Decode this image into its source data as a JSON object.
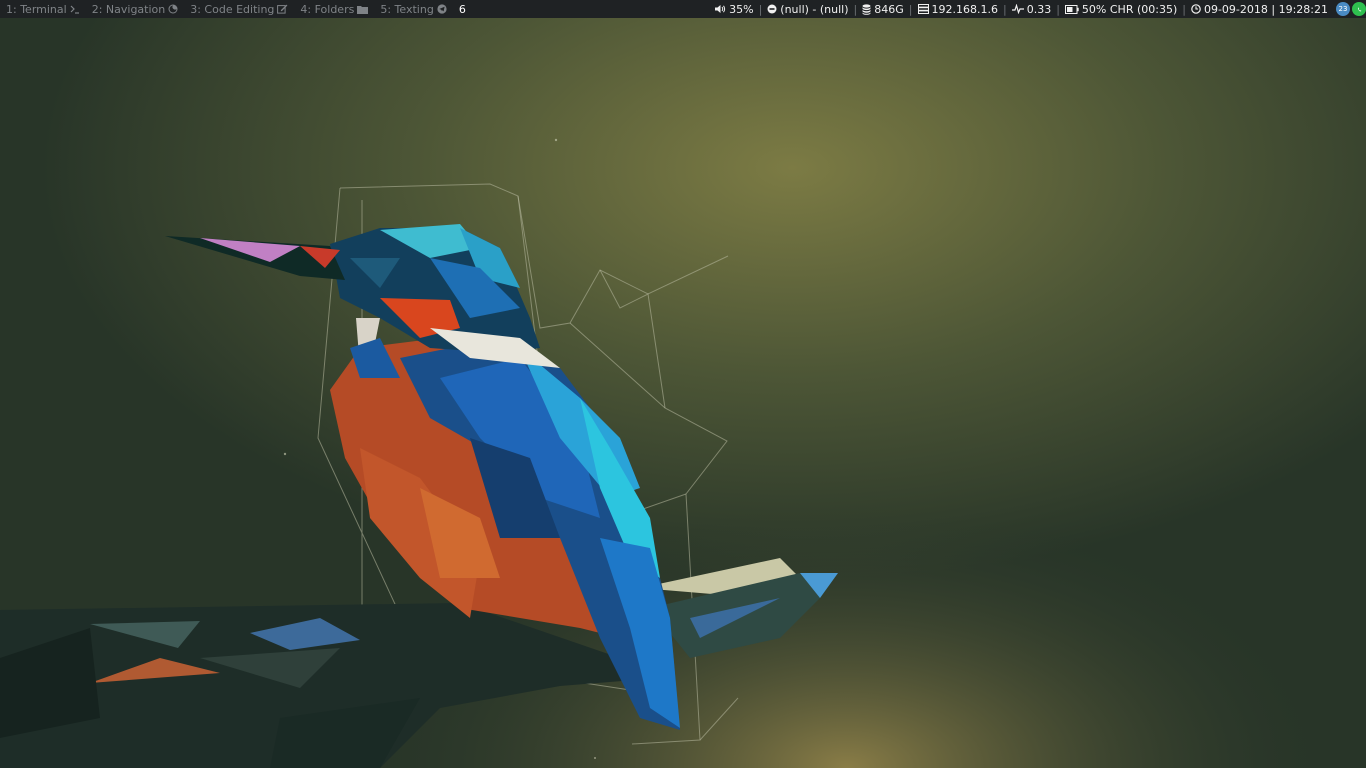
{
  "workspaces": [
    {
      "label": "1: Terminal",
      "icon": "terminal-icon",
      "focused": false
    },
    {
      "label": "2: Navigation",
      "icon": "firefox-icon",
      "focused": false
    },
    {
      "label": "3: Code Editing",
      "icon": "edit-icon",
      "focused": false
    },
    {
      "label": "4: Folders",
      "icon": "folder-icon",
      "focused": false
    },
    {
      "label": "5: Texting",
      "icon": "telegram-icon",
      "focused": false
    },
    {
      "label": "6",
      "icon": "",
      "focused": true
    }
  ],
  "status": {
    "volume": "35%",
    "media": "(null) - (null)",
    "disk": "846G",
    "ip": "192.168.1.6",
    "load": "0.33",
    "battery": "50% CHR (00:35)",
    "datetime": "09-09-2018 | 19:28:21",
    "separator": "|"
  },
  "tray": {
    "badge": "23",
    "icons": [
      "network-icon",
      "whatsapp-icon"
    ]
  },
  "colors": {
    "bar_bg": "#1f2224",
    "unfocused_text": "#7f8387",
    "focused_text": "#ffffff",
    "wall_base": "#2d3a2c",
    "wall_glow": "#7c7b44",
    "whatsapp": "#2fbf4f",
    "network": "#4a8bc4"
  }
}
